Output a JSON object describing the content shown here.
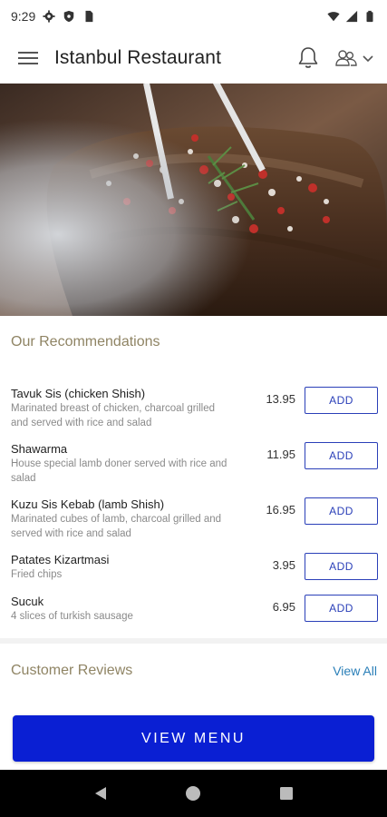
{
  "status_bar": {
    "time": "9:29",
    "icons": [
      "gear-icon",
      "shield-icon",
      "sim-card-icon",
      "wifi-icon",
      "signal-icon",
      "battery-icon"
    ]
  },
  "app_bar": {
    "title": "Istanbul Restaurant",
    "icons": [
      "hamburger-menu-icon",
      "bell-icon",
      "user-group-icon",
      "chevron-down-icon"
    ]
  },
  "hero": {
    "image": "grilled-meat-photo"
  },
  "recommendations": {
    "title": "Our Recommendations",
    "add_label": "ADD",
    "items": [
      {
        "name": "Tavuk Sis (chicken Shish)",
        "description_lines": [
          "Marinated breast of chicken, charcoal grilled",
          "and served with rice and salad"
        ],
        "price": "13.95"
      },
      {
        "name": "Shawarma",
        "description_lines": [
          "House special lamb doner served with rice and",
          "salad"
        ],
        "price": "11.95"
      },
      {
        "name": "Kuzu Sis Kebab (lamb Shish)",
        "description_lines": [
          "Marinated cubes of lamb, charcoal grilled and",
          "served with rice and salad"
        ],
        "price": "16.95"
      },
      {
        "name": "Patates Kizartmasi",
        "description_lines": [
          "Fried chips"
        ],
        "price": "3.95"
      },
      {
        "name": "Sucuk",
        "description_lines": [
          "4 slices of turkish sausage"
        ],
        "price": "6.95"
      }
    ]
  },
  "reviews": {
    "title": "Customer Reviews",
    "view_all_label": "View All"
  },
  "cta": {
    "view_menu_label": "VIEW MENU"
  },
  "nav_bar": {
    "icons": [
      "back-triangle-icon",
      "home-circle-icon",
      "recents-square-icon"
    ]
  },
  "colors": {
    "accent_blue": "#0a1fd3",
    "add_button_border": "#2a3fb8",
    "section_title": "#8f8464",
    "link": "#2a7fb8"
  }
}
